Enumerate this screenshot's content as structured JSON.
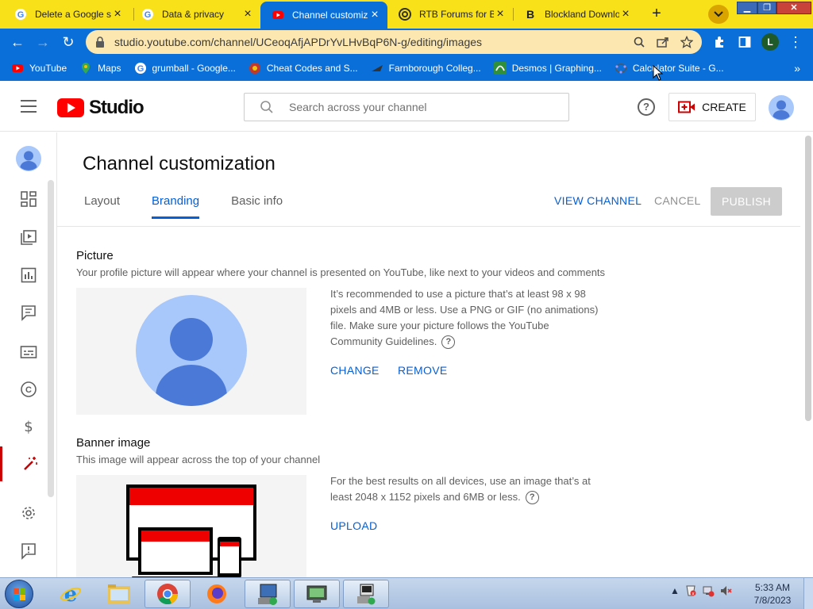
{
  "browser": {
    "tabs": [
      {
        "label": "Delete a Google s",
        "favicon": "google-icon",
        "active": false
      },
      {
        "label": "Data & privacy",
        "favicon": "google-icon",
        "active": false
      },
      {
        "label": "Channel customiz",
        "favicon": "youtube-icon",
        "active": true
      },
      {
        "label": "RTB Forums for Bl",
        "favicon": "rtb-icon",
        "active": false
      },
      {
        "label": "Blockland Downlo",
        "favicon": "blockland-icon",
        "active": false
      }
    ],
    "url": "studio.youtube.com/channel/UCeoqAfjAPDrYvLHvBqP6N-g/editing/images",
    "profile_initial": "L",
    "bookmarks": [
      {
        "label": "YouTube",
        "icon": "youtube-icon"
      },
      {
        "label": "Maps",
        "icon": "maps-icon"
      },
      {
        "label": "grumball - Google...",
        "icon": "google-icon"
      },
      {
        "label": "Cheat Codes and S...",
        "icon": "cheat-codes-icon"
      },
      {
        "label": "Farnborough Colleg...",
        "icon": "farnborough-icon"
      },
      {
        "label": "Desmos | Graphing...",
        "icon": "desmos-icon"
      },
      {
        "label": "Calculator Suite - G...",
        "icon": "geogebra-icon"
      }
    ],
    "colors": {
      "tabstrip": "#f9e11a",
      "toolbar": "#0a6fd8",
      "omnibox": "#fce7b0"
    }
  },
  "header": {
    "logo_text": "Studio",
    "search_placeholder": "Search across your channel",
    "create_label": "CREATE"
  },
  "page": {
    "title": "Channel customization",
    "tabs": [
      {
        "label": "Layout",
        "active": false
      },
      {
        "label": "Branding",
        "active": true
      },
      {
        "label": "Basic info",
        "active": false
      }
    ],
    "actions": {
      "view_channel": "VIEW CHANNEL",
      "cancel": "CANCEL",
      "publish": "PUBLISH"
    },
    "picture": {
      "title": "Picture",
      "description": "Your profile picture will appear where your channel is presented on YouTube, like next to your videos and comments",
      "info": "It’s recommended to use a picture that’s at least 98 x 98 pixels and 4MB or less. Use a PNG or GIF (no animations) file. Make sure your picture follows the YouTube Community Guidelines.",
      "change_label": "CHANGE",
      "remove_label": "REMOVE"
    },
    "banner": {
      "title": "Banner image",
      "description": "This image will appear across the top of your channel",
      "info": "For the best results on all devices, use an image that’s at least 2048 x 1152 pixels and 6MB or less.",
      "upload_label": "UPLOAD"
    },
    "accent_color": "#065fd4"
  },
  "taskbar": {
    "clock_time": "5:33 AM",
    "clock_date": "7/8/2023"
  }
}
